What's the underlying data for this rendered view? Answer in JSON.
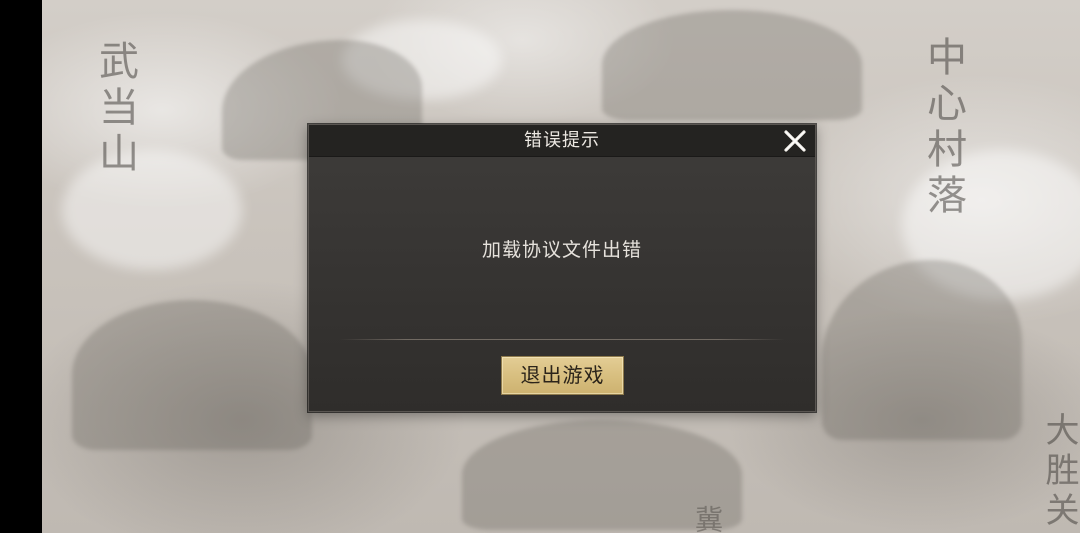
{
  "map": {
    "places": {
      "wudang": "武当山",
      "center_village": "中心村落",
      "dashengguan": "大胜关",
      "bottom_partial": "冀"
    }
  },
  "dialog": {
    "title": "错误提示",
    "message": "加载协议文件出错",
    "exit_button_label": "退出游戏",
    "close_icon": "close-icon"
  },
  "colors": {
    "dialog_bg": "#353331",
    "header_bg": "#242321",
    "button_gold": "#d8bf80",
    "text_light": "#ece8e2"
  }
}
